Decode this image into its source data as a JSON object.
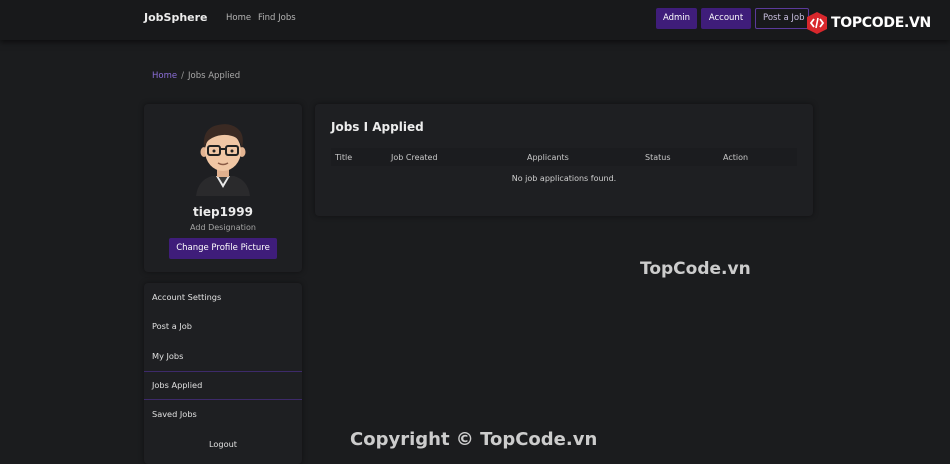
{
  "navbar": {
    "brand": "JobSphere",
    "links": [
      "Home",
      "Find Jobs"
    ],
    "admin_label": "Admin",
    "account_label": "Account",
    "post_job_label": "Post a Job"
  },
  "logo": {
    "text": "TOPCODE.VN"
  },
  "breadcrumb": {
    "home": "Home",
    "separator": "/",
    "current": "Jobs Applied"
  },
  "profile": {
    "avatar_icon": "avatar-cartoon-man-glasses",
    "username": "tiep1999",
    "designation": "Add Designation",
    "change_picture_label": "Change Profile Picture"
  },
  "sidebar_menu": {
    "items": [
      {
        "label": "Account Settings"
      },
      {
        "label": "Post a Job"
      },
      {
        "label": "My Jobs"
      },
      {
        "label": "Jobs Applied",
        "active": true
      },
      {
        "label": "Saved Jobs"
      },
      {
        "label": "Logout"
      }
    ]
  },
  "jobs_applied": {
    "title": "Jobs I Applied",
    "columns": [
      "Title",
      "Job Created",
      "Applicants",
      "Status",
      "Action"
    ],
    "empty_message": "No job applications found."
  },
  "watermarks": {
    "middle": "TopCode.vn",
    "bottom": "Copyright © TopCode.vn"
  },
  "colors": {
    "background": "#1b1c1e",
    "card": "#1e1f22",
    "accent": "#3f1d7a",
    "link_accent": "#8b6ed8"
  }
}
